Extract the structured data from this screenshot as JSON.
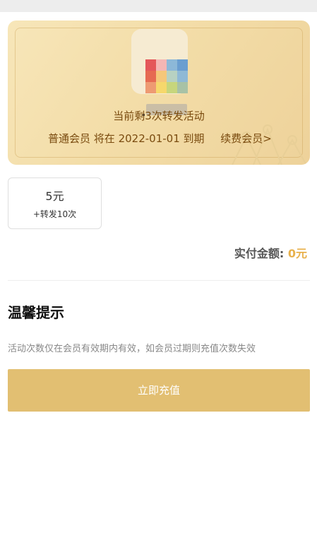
{
  "membership_card": {
    "remaining_text": "当前剩3次转发活动",
    "member_type": "普通会员",
    "expire_text": "将在 2022-01-01 到期",
    "renew_link": "续费会员>"
  },
  "plan_option": {
    "price": "5元",
    "description": "+转发10次"
  },
  "payment": {
    "label": "实付金额:",
    "amount": "0元"
  },
  "tips": {
    "title": "温馨提示",
    "text": "活动次数仅在会员有效期内有效，如会员过期则充值次数失效"
  },
  "actions": {
    "recharge_label": "立即充值"
  },
  "colors": {
    "accent": "#e2bf72",
    "amount": "#e8b14c",
    "card_text": "#7a4b0f"
  },
  "avatar_mosaic": [
    "#e4575a",
    "#f4b6b4",
    "#8cb8d8",
    "#6a9ed0",
    "#e66a52",
    "#f5c77a",
    "#b7d1c2",
    "#8fb9d6",
    "#ee9a72",
    "#f6d86c",
    "#c7d67c",
    "#a8c2a6"
  ]
}
